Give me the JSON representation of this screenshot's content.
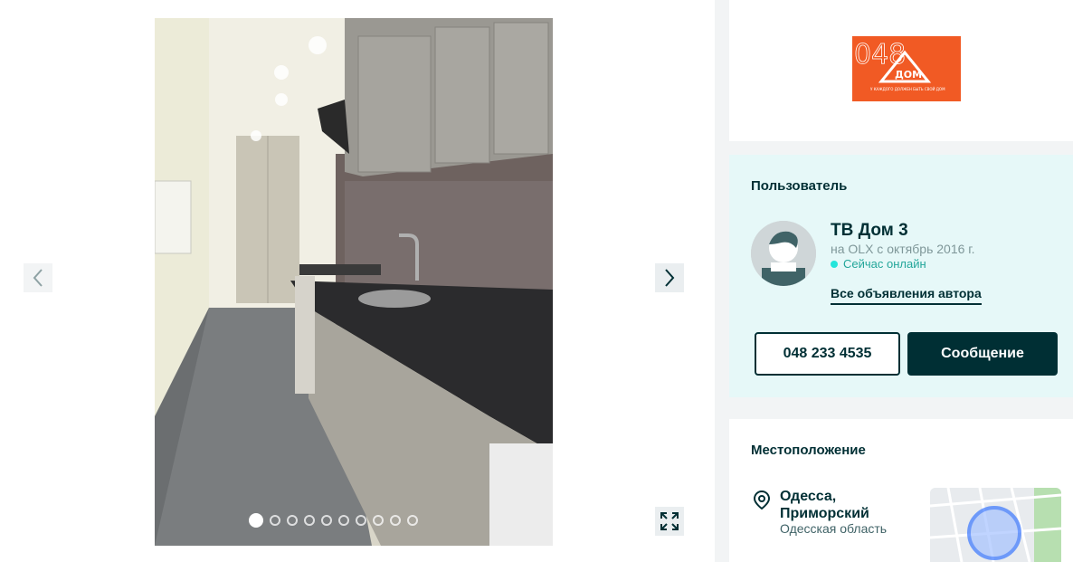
{
  "gallery": {
    "photo_count": 10,
    "active_index": 0,
    "prev_icon": "chevron-left-icon",
    "next_icon": "chevron-right-icon",
    "expand_icon": "expand-icon"
  },
  "logo": {
    "text": "048",
    "brand": "ДОМ",
    "slogan": "У КАЖДОГО ДОЛЖЕН БЫТЬ СВОЙ ДОМ",
    "color": "#f15a24"
  },
  "user": {
    "section_title": "Пользователь",
    "name": "ТВ Дом 3",
    "since": "на OLX с октябрь 2016 г.",
    "online": "Сейчас онлайн",
    "all_ads_link": "Все объявления автора",
    "phone_button": "048 233 4535",
    "message_button": "Сообщение"
  },
  "location": {
    "section_title": "Местоположение",
    "city_line1": "Одесса,",
    "city_line2": "Приморский",
    "region": "Одесская область",
    "pin_icon": "location-pin-icon"
  },
  "colors": {
    "brand_dark": "#002f34",
    "user_card_bg": "#e6f8f8",
    "online": "#23e5db",
    "map_marker": "#3a77ff"
  }
}
